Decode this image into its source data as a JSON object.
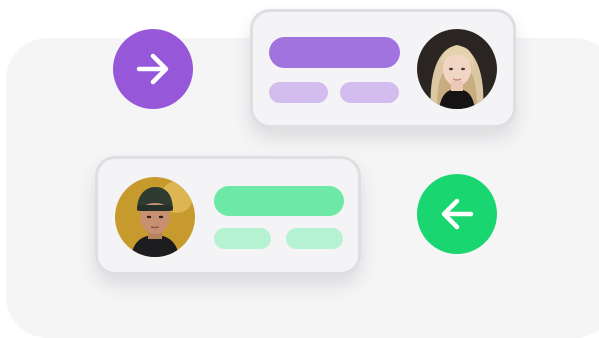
{
  "colors": {
    "panel_background": "#f5f5f6",
    "card_background": "#f4f4f6",
    "card_border": "#dedee3",
    "purple_accent": "#9657d9",
    "purple_bar": "#a073de",
    "purple_bar_light": "#d2bdee",
    "green_accent": "#1ad671",
    "green_bar": "#6de8a6",
    "green_bar_light": "#b5f2d2"
  },
  "forward_button": {
    "icon": "arrow-right-icon",
    "color": "#9657d9"
  },
  "back_button": {
    "icon": "arrow-left-icon",
    "color": "#1ad671"
  },
  "card_top": {
    "avatar": "avatar-woman-blonde",
    "theme": "purple"
  },
  "card_bottom": {
    "avatar": "avatar-man-beanie",
    "theme": "green"
  }
}
